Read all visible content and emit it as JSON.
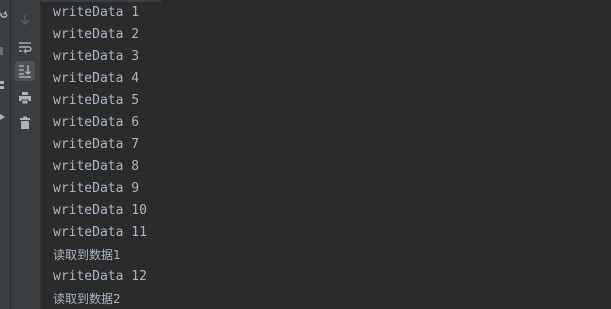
{
  "toolbar": {
    "icons": [
      "scroll-down-icon",
      "soft-wrap-icon",
      "scroll-to-end-icon",
      "print-icon",
      "trash-icon"
    ]
  },
  "console": {
    "lines": [
      "writeData 1",
      "writeData 2",
      "writeData 3",
      "writeData 4",
      "writeData 5",
      "writeData 6",
      "writeData 7",
      "writeData 8",
      "writeData 9",
      "writeData 10",
      "writeData 11",
      "读取到数据1",
      "writeData 12",
      "读取到数据2"
    ]
  },
  "colors": {
    "background": "#2b2b2b",
    "toolbar": "#3c3f41",
    "text": "#a9b7c6",
    "icon": "#afb1b3"
  }
}
